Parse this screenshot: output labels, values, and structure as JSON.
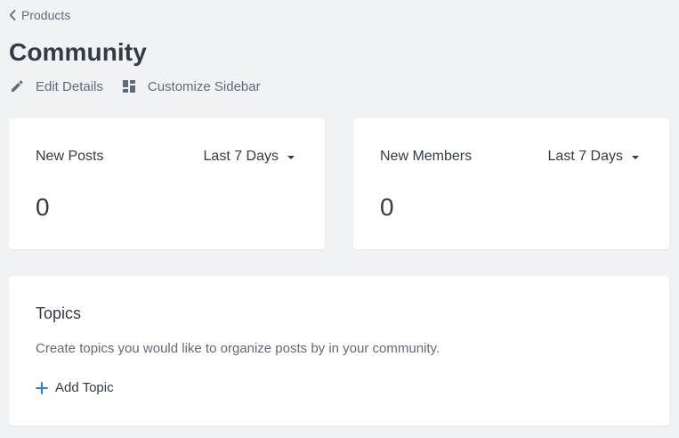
{
  "breadcrumb": {
    "label": "Products",
    "icon": "chevron-left-icon"
  },
  "header": {
    "title": "Community",
    "actions": [
      {
        "label": "Edit Details",
        "icon": "pencil-icon"
      },
      {
        "label": "Customize Sidebar",
        "icon": "dashboard-layout-icon"
      }
    ]
  },
  "stats": [
    {
      "label": "New Posts",
      "range": "Last 7 Days",
      "value": "0"
    },
    {
      "label": "New Members",
      "range": "Last 7 Days",
      "value": "0"
    }
  ],
  "topics": {
    "title": "Topics",
    "description": "Create topics you would like to organize posts by in your community.",
    "add_label": "Add Topic",
    "add_icon": "plus-icon"
  },
  "colors": {
    "background": "#f1f2f4",
    "card": "#ffffff",
    "text": "#333b45",
    "muted": "#5f6b78",
    "accent": "#2b7bd6"
  }
}
